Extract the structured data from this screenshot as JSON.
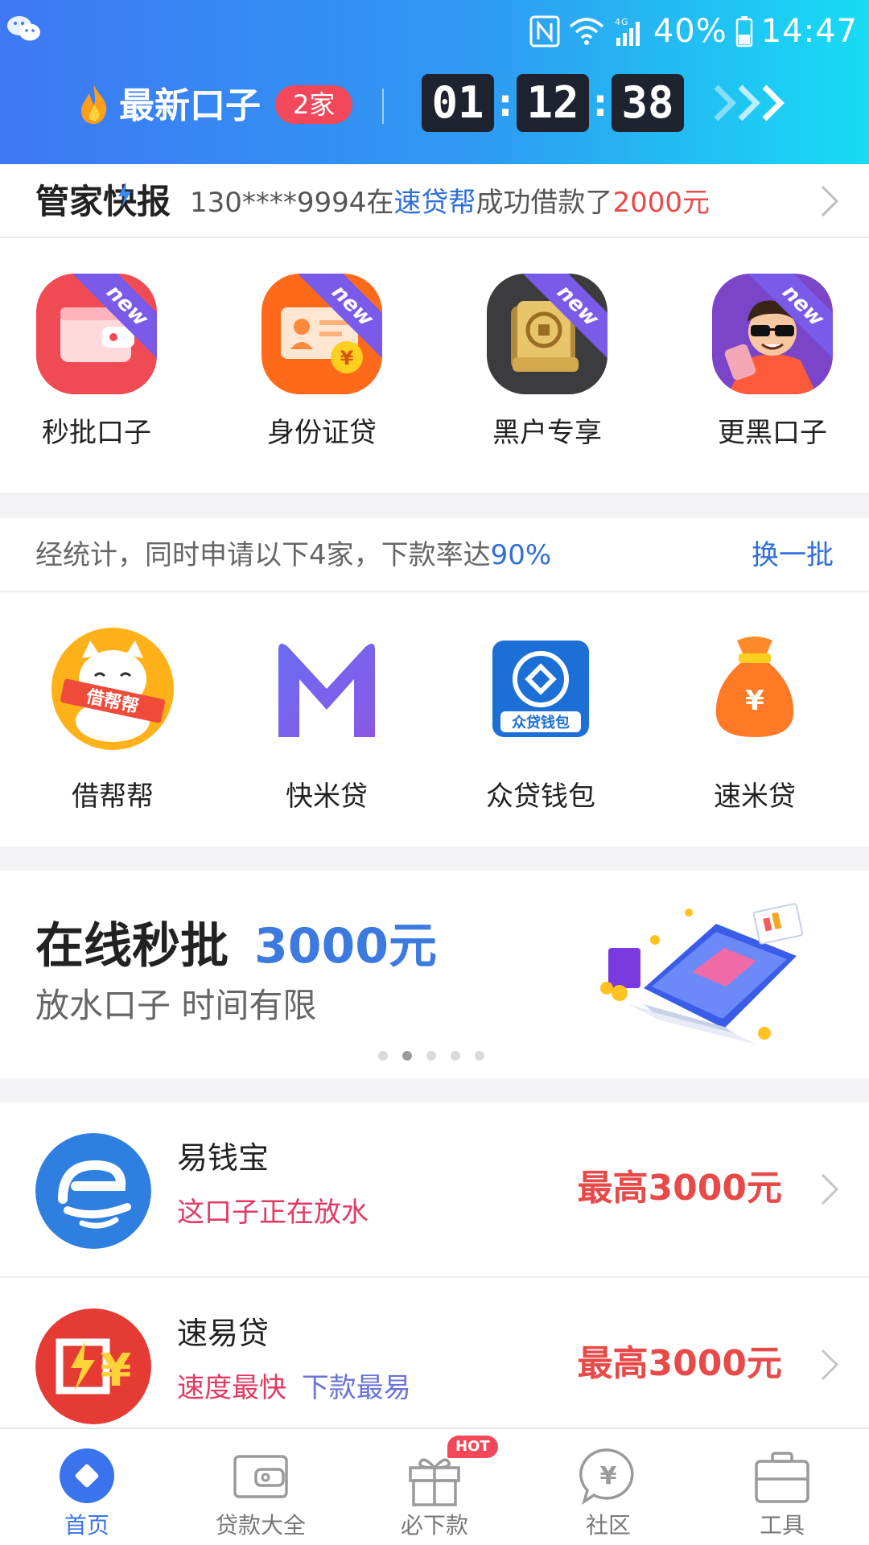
{
  "status_bar": {
    "battery": "40%",
    "time": "14:47",
    "network": "4G",
    "icons": [
      "wechat-icon",
      "nfc-icon",
      "wifi-icon",
      "signal-icon",
      "battery-icon"
    ]
  },
  "promo": {
    "title": "最新口子",
    "badge": "2家",
    "countdown": {
      "hours": "01",
      "minutes": "12",
      "seconds": "38",
      "separator": ":"
    }
  },
  "ticker": {
    "title": "管家快报",
    "prefix": "130****9994在",
    "platform": "速贷帮",
    "middle": "成功借款了",
    "amount": "2000元"
  },
  "quick_entries": [
    {
      "label": "秒批口子",
      "ribbon": "new",
      "icon": "wallet-icon",
      "color": "#f04b55"
    },
    {
      "label": "身份证贷",
      "ribbon": "new",
      "icon": "id-card-icon",
      "color": "#ff6a1a"
    },
    {
      "label": "黑户专享",
      "ribbon": "new",
      "icon": "scroll-icon",
      "color": "#3c3c3f"
    },
    {
      "label": "更黑口子",
      "ribbon": "new",
      "icon": "sunglasses-man-icon",
      "color": "#7a45c9"
    }
  ],
  "recommend": {
    "text_prefix": "经统计，同时申请以下4家，下款率达",
    "rate": "90%",
    "switch_label": "换一批",
    "items": [
      {
        "label": "借帮帮",
        "icon": "lucky-cat-icon",
        "sash": "借帮帮"
      },
      {
        "label": "快米贷",
        "icon": "m-logo-icon"
      },
      {
        "label": "众贷钱包",
        "icon": "zhongdai-wallet-icon",
        "caption": "众贷钱包"
      },
      {
        "label": "速米贷",
        "icon": "money-bag-icon"
      }
    ]
  },
  "banner": {
    "title": "在线秒批",
    "amount": "3000元",
    "subtitle": "放水口子 时间有限",
    "pages": 5,
    "active_page": 2
  },
  "loans": [
    {
      "name": "易钱宝",
      "logo_char": "易",
      "tags": [
        {
          "text": "这口子正在放水",
          "color": "#e23a63"
        }
      ],
      "max": "最高3000元"
    },
    {
      "name": "速易贷",
      "logo_char": "¥",
      "tags": [
        {
          "text": "速度最快",
          "color": "#e23a63"
        },
        {
          "text": "下款最易",
          "color": "#6b72d8"
        }
      ],
      "max": "最高3000元"
    }
  ],
  "nav": {
    "items": [
      {
        "label": "首页",
        "icon": "home-diamond-icon",
        "active": true
      },
      {
        "label": "贷款大全",
        "icon": "wallet-outline-icon",
        "active": false
      },
      {
        "label": "必下款",
        "icon": "gift-icon",
        "active": false,
        "badge": "HOT"
      },
      {
        "label": "社区",
        "icon": "yuan-chat-icon",
        "active": false
      },
      {
        "label": "工具",
        "icon": "briefcase-icon",
        "active": false
      }
    ]
  },
  "colors": {
    "header_gradient": [
      "#3e78f4",
      "#17dcf4"
    ],
    "accent_blue": "#2e6fd9",
    "accent_red": "#e84a4a",
    "nav_active": "#3a73ee"
  }
}
